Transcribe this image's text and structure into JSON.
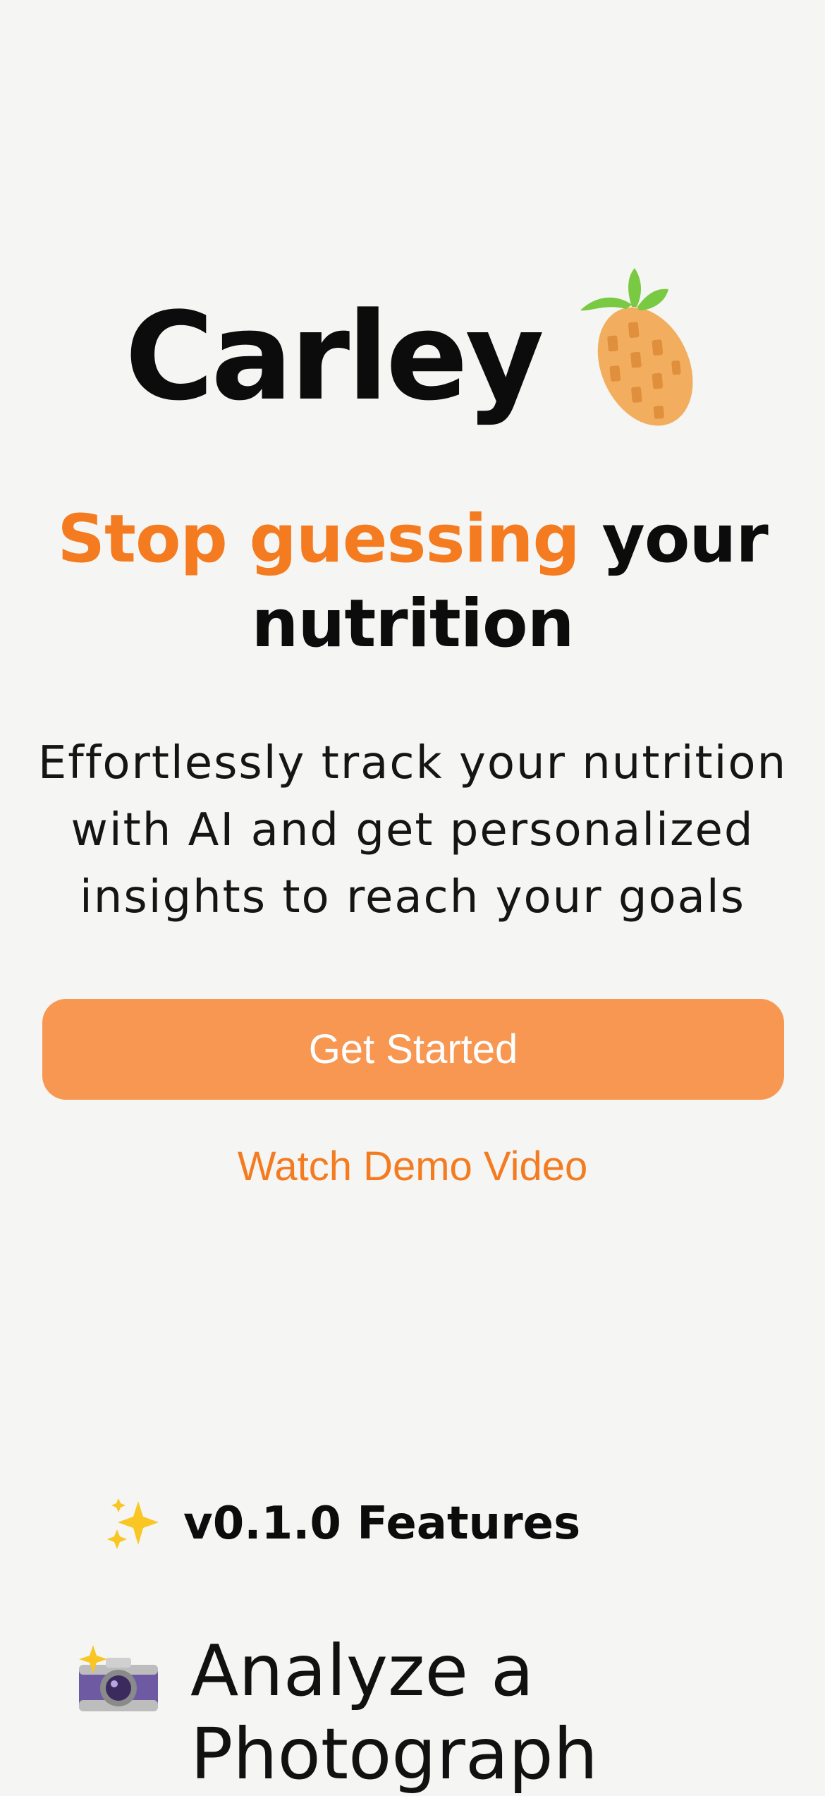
{
  "brand": {
    "name": "Carley",
    "logo_icon": "pineapple-icon"
  },
  "hero": {
    "headline_accent": "Stop guessing",
    "headline_rest_line1": " your",
    "headline_line2": "nutrition",
    "subtitle_line1": "Effortlessly track your nutrition",
    "subtitle_line2": "with AI and get personalized",
    "subtitle_line3": "insights to reach your goals",
    "primary_button": "Get Started",
    "secondary_link": "Watch Demo Video"
  },
  "features": {
    "heading_icon": "sparkles-icon",
    "heading": "v0.1.0 Features",
    "items": [
      {
        "icon": "camera-flash-icon",
        "title_line1": "Analyze a",
        "title_line2": "Photograph"
      }
    ]
  },
  "colors": {
    "background": "#f5f5f3",
    "accent": "#f47b20",
    "button": "#f89752",
    "text": "#0c0c0c"
  }
}
